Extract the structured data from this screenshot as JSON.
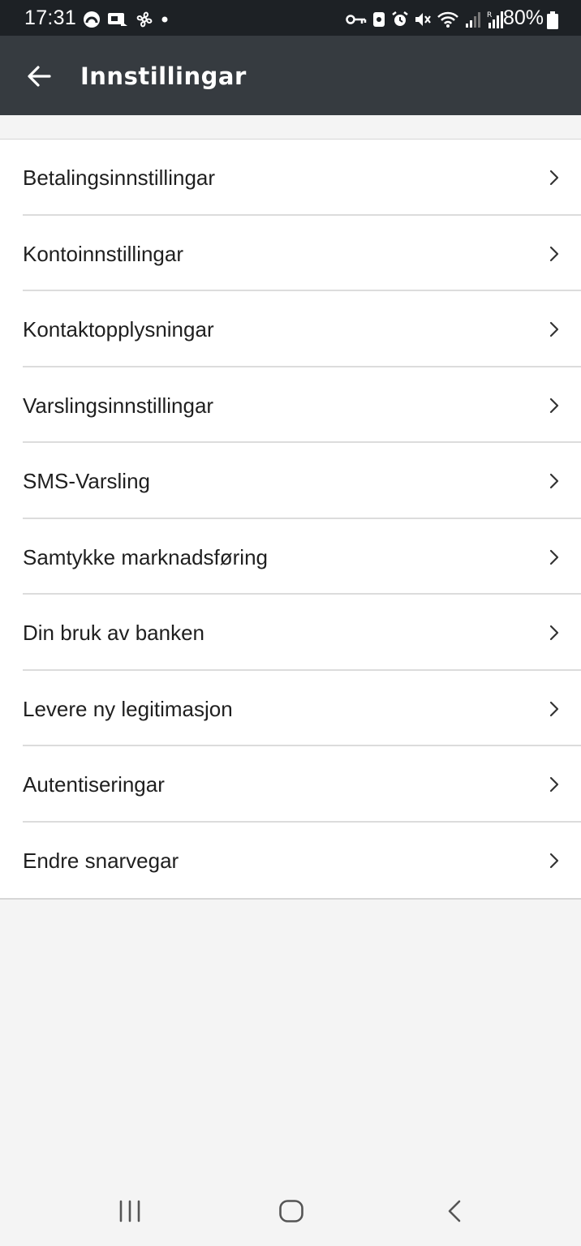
{
  "status_bar": {
    "time": "17:31",
    "battery": "80%",
    "left_icons": [
      "headset-notification-icon",
      "cast-notification-icon",
      "fan-notification-icon",
      "dot-icon"
    ],
    "right_icons": [
      "vpn-key-icon",
      "lock-app-icon",
      "alarm-icon",
      "mute-icon",
      "wifi-icon",
      "signal-icon",
      "signal-roaming-icon",
      "battery-icon"
    ]
  },
  "app_bar": {
    "title": "Innstillingar",
    "back_icon": "arrow-left-icon"
  },
  "settings": {
    "items": [
      {
        "label": "Betalingsinnstillingar"
      },
      {
        "label": "Kontoinnstillingar"
      },
      {
        "label": "Kontaktopplysningar"
      },
      {
        "label": "Varslingsinnstillingar"
      },
      {
        "label": "SMS-Varsling"
      },
      {
        "label": "Samtykke marknadsføring"
      },
      {
        "label": "Din bruk av banken"
      },
      {
        "label": "Levere ny legitimasjon"
      },
      {
        "label": "Autentiseringar"
      },
      {
        "label": "Endre snarvegar"
      }
    ]
  },
  "nav_bar": {
    "buttons": [
      "recent-apps-icon",
      "home-icon",
      "back-icon"
    ]
  },
  "colors": {
    "status_bar_bg": "#1d2125",
    "app_bar_bg": "#363b40",
    "page_bg": "#f4f4f4",
    "list_bg": "#ffffff",
    "text": "#1f1f1f",
    "divider": "#dcdcdc"
  }
}
